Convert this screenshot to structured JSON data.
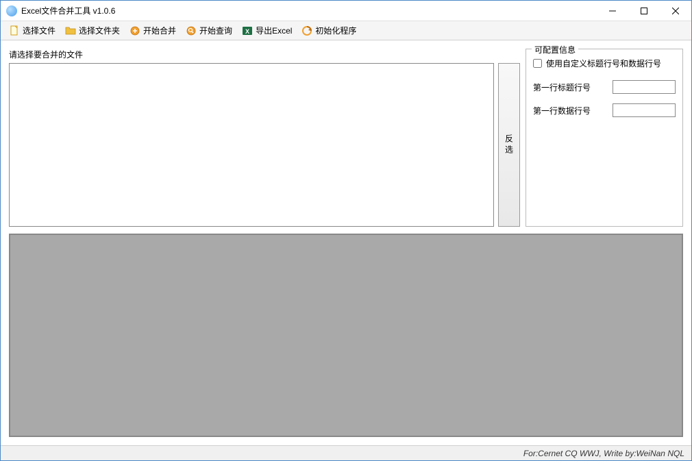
{
  "window": {
    "title": "Excel文件合并工具 v1.0.6"
  },
  "toolbar": {
    "select_file": "选择文件",
    "select_folder": "选择文件夹",
    "start_merge": "开始合并",
    "start_query": "开始查询",
    "export_excel": "导出Excel",
    "init_program": "初始化程序"
  },
  "file_section": {
    "label": "请选择要合并的文件",
    "invert_button": "反选"
  },
  "config": {
    "title": "可配置信息",
    "use_custom_label": "使用自定义标题行号和数据行号",
    "title_row_label": "第一行标题行号",
    "title_row_value": "",
    "data_row_label": "第一行数据行号",
    "data_row_value": ""
  },
  "statusbar": {
    "text": "For:Cernet CQ WWJ, Write by:WeiNan NQL"
  }
}
